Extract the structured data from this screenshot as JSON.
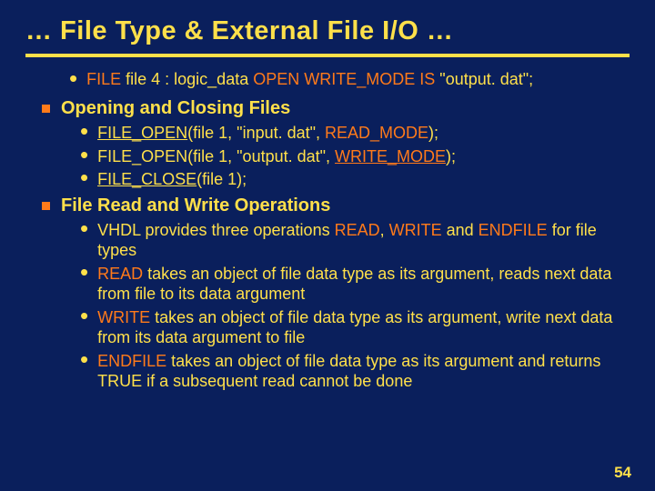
{
  "title": "… File Type & External File I/O …",
  "lead": {
    "pre": "FILE",
    "mid1": " file 4 : logic_data ",
    "kw2": "OPEN",
    "mid2": " ",
    "kw3": "WRITE_MODE",
    "mid3": " ",
    "kw4": "IS",
    "mid4": " \"output. dat\";"
  },
  "sections": [
    {
      "heading": "Opening and Closing Files",
      "items": [
        {
          "segments": [
            {
              "t": "FILE_OPEN",
              "u": true,
              "kw": false
            },
            {
              "t": "(file 1, \"input. dat\", "
            },
            {
              "t": "READ_MODE",
              "kw": true
            },
            {
              "t": ");"
            }
          ]
        },
        {
          "segments": [
            {
              "t": "FILE_OPEN(file 1, \"output. dat\", "
            },
            {
              "t": "WRITE_MODE",
              "kw": true,
              "u": true
            },
            {
              "t": ");"
            }
          ]
        },
        {
          "segments": [
            {
              "t": "FILE_CLOSE",
              "u": true
            },
            {
              "t": "(file 1);"
            }
          ]
        }
      ]
    },
    {
      "heading": "File Read and Write Operations",
      "items": [
        {
          "segments": [
            {
              "t": "VHDL provides three operations "
            },
            {
              "t": "READ",
              "kw": true
            },
            {
              "t": ", "
            },
            {
              "t": "WRITE",
              "kw": true
            },
            {
              "t": " and "
            },
            {
              "t": "ENDFILE",
              "kw": true
            },
            {
              "t": " for file types"
            }
          ]
        },
        {
          "segments": [
            {
              "t": "READ",
              "kw": true
            },
            {
              "t": " takes an object of file data type as its argument, reads next data from file to its data argument"
            }
          ]
        },
        {
          "segments": [
            {
              "t": "WRITE",
              "kw": true
            },
            {
              "t": " takes an object of file data type as its argument, write next data from its data argument to file"
            }
          ]
        },
        {
          "segments": [
            {
              "t": "ENDFILE",
              "kw": true
            },
            {
              "t": " takes an object of file data type as its argument and returns TRUE if a subsequent read cannot be done"
            }
          ]
        }
      ]
    }
  ],
  "page": "54"
}
